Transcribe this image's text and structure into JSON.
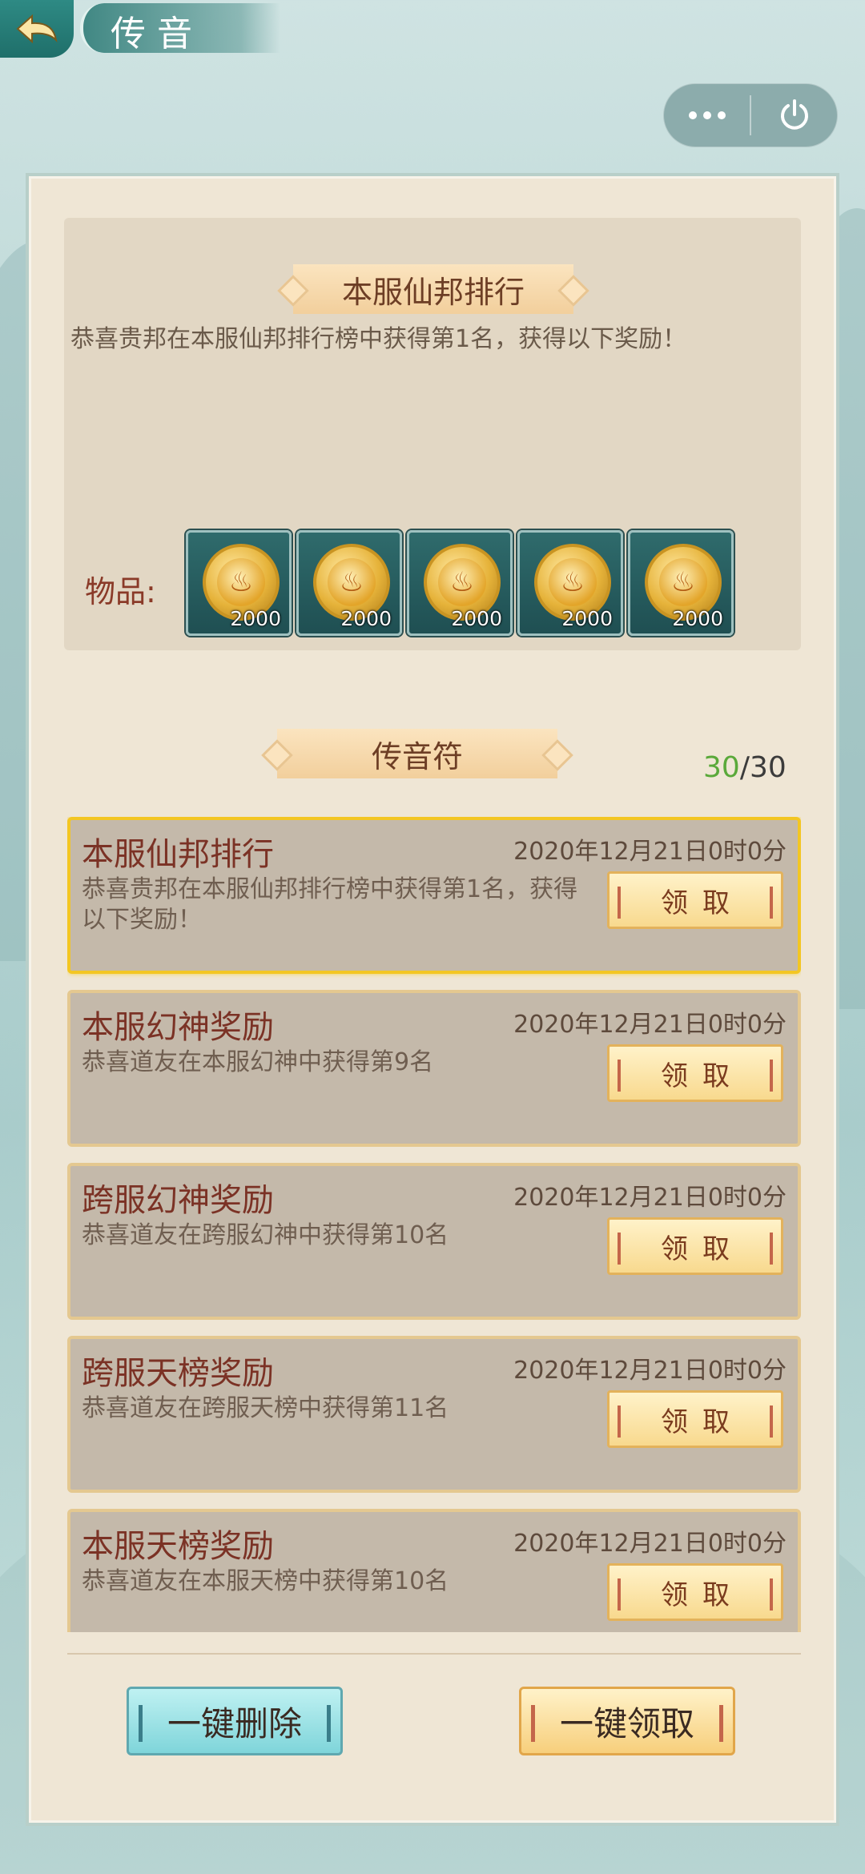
{
  "header": {
    "title": "传音",
    "back_icon": "back-arrow-icon"
  },
  "capsule": {
    "more_icon": "more-dots-icon",
    "power_icon": "power-icon"
  },
  "detail": {
    "heading": "本服仙邦排行",
    "message": "恭喜贵邦在本服仙邦排行榜中获得第1名，获得以下奖励！",
    "items_label": "物品:",
    "items": [
      {
        "icon": "gold-coin-icon",
        "qty": "2000"
      },
      {
        "icon": "gold-coin-icon",
        "qty": "2000"
      },
      {
        "icon": "gold-coin-icon",
        "qty": "2000"
      },
      {
        "icon": "gold-coin-icon",
        "qty": "2000"
      },
      {
        "icon": "gold-coin-icon",
        "qty": "2000"
      }
    ]
  },
  "section": {
    "heading": "传音符",
    "count_current": "30",
    "count_sep_total": "/30"
  },
  "messages": [
    {
      "title": "本服仙邦排行",
      "time": "2020年12月21日0时0分",
      "desc": "恭喜贵邦在本服仙邦排行榜中获得第1名，获得以下奖励！",
      "button": "领取",
      "selected": true
    },
    {
      "title": "本服幻神奖励",
      "time": "2020年12月21日0时0分",
      "desc": "恭喜道友在本服幻神中获得第9名",
      "button": "领取"
    },
    {
      "title": "跨服幻神奖励",
      "time": "2020年12月21日0时0分",
      "desc": "恭喜道友在跨服幻神中获得第10名",
      "button": "领取"
    },
    {
      "title": "跨服天榜奖励",
      "time": "2020年12月21日0时0分",
      "desc": "恭喜道友在跨服天榜中获得第11名",
      "button": "领取"
    },
    {
      "title": "本服天榜奖励",
      "time": "2020年12月21日0时0分",
      "desc": "恭喜道友在本服天榜中获得第10名",
      "button": "领取"
    }
  ],
  "footer": {
    "delete_all": "一键删除",
    "collect_all": "一键领取"
  },
  "colors": {
    "title_red": "#7b3225",
    "count_green": "#5aa93a",
    "selected_border": "#f3c623"
  }
}
